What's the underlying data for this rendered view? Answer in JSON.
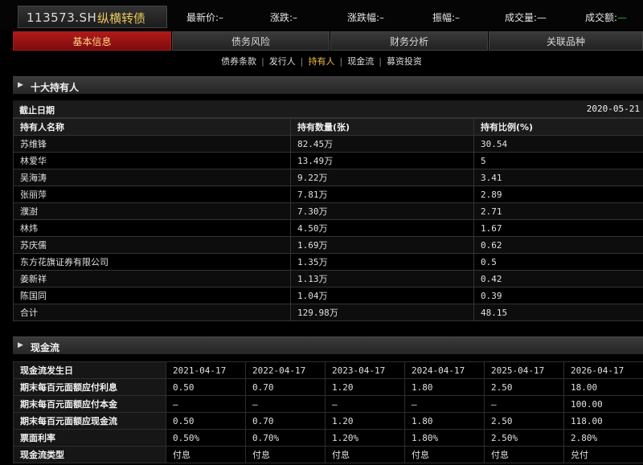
{
  "header": {
    "code": "113573.SH",
    "name": "纵横转债",
    "quotes": [
      {
        "label": "最新价:",
        "value": "–"
      },
      {
        "label": "涨跌:",
        "value": "–"
      },
      {
        "label": "涨跌幅:",
        "value": "–"
      },
      {
        "label": "振幅:",
        "value": "–"
      },
      {
        "label": "成交量:",
        "value": "—"
      },
      {
        "label": "成交额:",
        "value": "—"
      }
    ]
  },
  "tabs": [
    "基本信息",
    "债务风险",
    "财务分析",
    "关联品种"
  ],
  "subnav": [
    "债券条款",
    "发行人",
    "持有人",
    "现金流",
    "募资投资"
  ],
  "holders_section": {
    "title": "十大持有人",
    "date_label": "截止日期",
    "date_value": "2020-05-21",
    "columns": [
      "持有人名称",
      "持有数量(张)",
      "持有比例(%)"
    ],
    "rows": [
      [
        "苏维锋",
        "82.45万",
        "30.54"
      ],
      [
        "林爱华",
        "13.49万",
        "5"
      ],
      [
        "吴海涛",
        "9.22万",
        "3.41"
      ],
      [
        "张丽萍",
        "7.81万",
        "2.89"
      ],
      [
        "濮澍",
        "7.30万",
        "2.71"
      ],
      [
        "林炜",
        "4.50万",
        "1.67"
      ],
      [
        "苏庆儒",
        "1.69万",
        "0.62"
      ],
      [
        "东方花旗证券有限公司",
        "1.35万",
        "0.5"
      ],
      [
        "姜新祥",
        "1.13万",
        "0.42"
      ],
      [
        "陈国同",
        "1.04万",
        "0.39"
      ],
      [
        "合计",
        "129.98万",
        "48.15"
      ]
    ]
  },
  "cashflow_section": {
    "title": "现金流",
    "header_label": "现金流发生日",
    "dates": [
      "2021-04-17",
      "2022-04-17",
      "2023-04-17",
      "2024-04-17",
      "2025-04-17",
      "2026-04-17"
    ],
    "rows": [
      {
        "label": "期末每百元面额应付利息",
        "values": [
          "0.50",
          "0.70",
          "1.20",
          "1.80",
          "2.50",
          "18.00"
        ]
      },
      {
        "label": "期末每百元面额应付本金",
        "values": [
          "—",
          "—",
          "—",
          "—",
          "—",
          "100.00"
        ]
      },
      {
        "label": "期末每百元面额应现金流",
        "values": [
          "0.50",
          "0.70",
          "1.20",
          "1.80",
          "2.50",
          "118.00"
        ]
      },
      {
        "label": "票面利率",
        "values": [
          "0.50%",
          "0.70%",
          "1.20%",
          "1.80%",
          "2.50%",
          "2.80%"
        ]
      },
      {
        "label": "现金流类型",
        "values": [
          "付息",
          "付息",
          "付息",
          "付息",
          "付息",
          "兑付"
        ]
      }
    ]
  }
}
